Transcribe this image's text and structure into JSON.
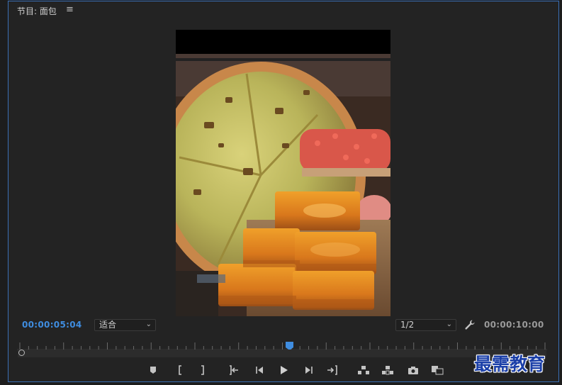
{
  "panel": {
    "title": "节目: 面包",
    "menu_icon": "hamburger-menu-icon"
  },
  "timecode": {
    "current": "00:00:05:04",
    "duration": "00:00:10:00"
  },
  "zoom_select": {
    "value": "适合"
  },
  "resolution_select": {
    "value": "1/2"
  },
  "playhead_position": 0.51,
  "transport": [
    {
      "name": "add-marker-button",
      "icon": "marker-icon"
    },
    {
      "name": "mark-in-button",
      "icon": "mark-in-icon"
    },
    {
      "name": "mark-out-button",
      "icon": "mark-out-icon"
    },
    {
      "name": "go-to-in-button",
      "icon": "go-to-in-icon"
    },
    {
      "name": "step-back-button",
      "icon": "step-back-icon"
    },
    {
      "name": "play-button",
      "icon": "play-icon"
    },
    {
      "name": "step-forward-button",
      "icon": "step-forward-icon"
    },
    {
      "name": "go-to-out-button",
      "icon": "go-to-out-icon"
    },
    {
      "name": "lift-button",
      "icon": "lift-icon"
    },
    {
      "name": "extract-button",
      "icon": "extract-icon"
    },
    {
      "name": "export-frame-button",
      "icon": "camera-icon"
    },
    {
      "name": "compare-view-button",
      "icon": "compare-icon"
    }
  ],
  "watermark": "最需教育",
  "colors": {
    "accent": "#3f8de0",
    "panel_border": "#3a6fb4",
    "background": "#232323"
  }
}
